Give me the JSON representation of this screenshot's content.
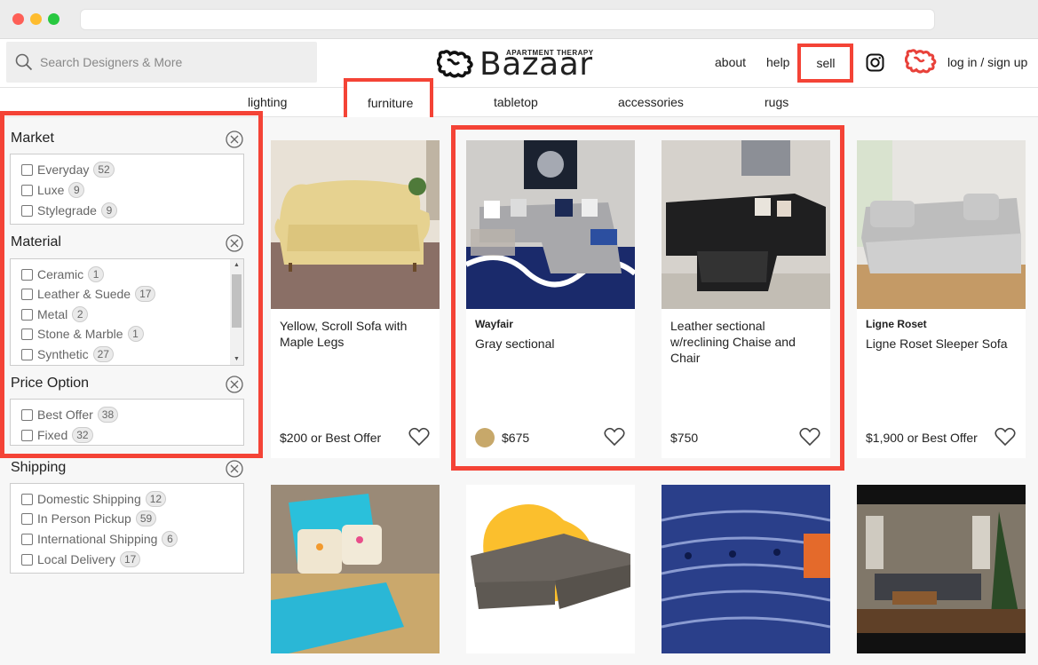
{
  "search": {
    "placeholder": "Search Designers & More"
  },
  "logo": {
    "tagline": "APARTMENT THERAPY",
    "name": "Bazaar"
  },
  "nav": {
    "about": "about",
    "help": "help",
    "sell": "sell",
    "login": "log in / sign up"
  },
  "categories": [
    "lighting",
    "furniture",
    "tabletop",
    "accessories",
    "rugs"
  ],
  "filters": [
    {
      "title": "Market",
      "items": [
        {
          "label": "Everyday",
          "count": "52"
        },
        {
          "label": "Luxe",
          "count": "9"
        },
        {
          "label": "Stylegrade",
          "count": "9"
        }
      ]
    },
    {
      "title": "Material",
      "items": [
        {
          "label": "Ceramic",
          "count": "1"
        },
        {
          "label": "Leather & Suede",
          "count": "17"
        },
        {
          "label": "Metal",
          "count": "2"
        },
        {
          "label": "Stone & Marble",
          "count": "1"
        },
        {
          "label": "Synthetic",
          "count": "27"
        }
      ]
    },
    {
      "title": "Price Option",
      "items": [
        {
          "label": "Best Offer",
          "count": "38"
        },
        {
          "label": "Fixed",
          "count": "32"
        }
      ]
    },
    {
      "title": "Shipping",
      "items": [
        {
          "label": "Domestic Shipping",
          "count": "12"
        },
        {
          "label": "In Person Pickup",
          "count": "59"
        },
        {
          "label": "International Shipping",
          "count": "6"
        },
        {
          "label": "Local Delivery",
          "count": "17"
        }
      ]
    }
  ],
  "products": [
    {
      "brand": "",
      "title": "Yellow, Scroll Sofa with Maple Legs",
      "price": "$200 or Best Offer"
    },
    {
      "brand": "Wayfair",
      "title": "Gray sectional",
      "price": "$675"
    },
    {
      "brand": "",
      "title": "Leather sectional w/reclining Chaise and Chair",
      "price": "$750"
    },
    {
      "brand": "Ligne Roset",
      "title": "Ligne Roset Sleeper Sofa",
      "price": "$1,900 or Best Offer"
    }
  ],
  "colors": {
    "highlight": "#f44336",
    "accent_red": "#e8413a"
  }
}
